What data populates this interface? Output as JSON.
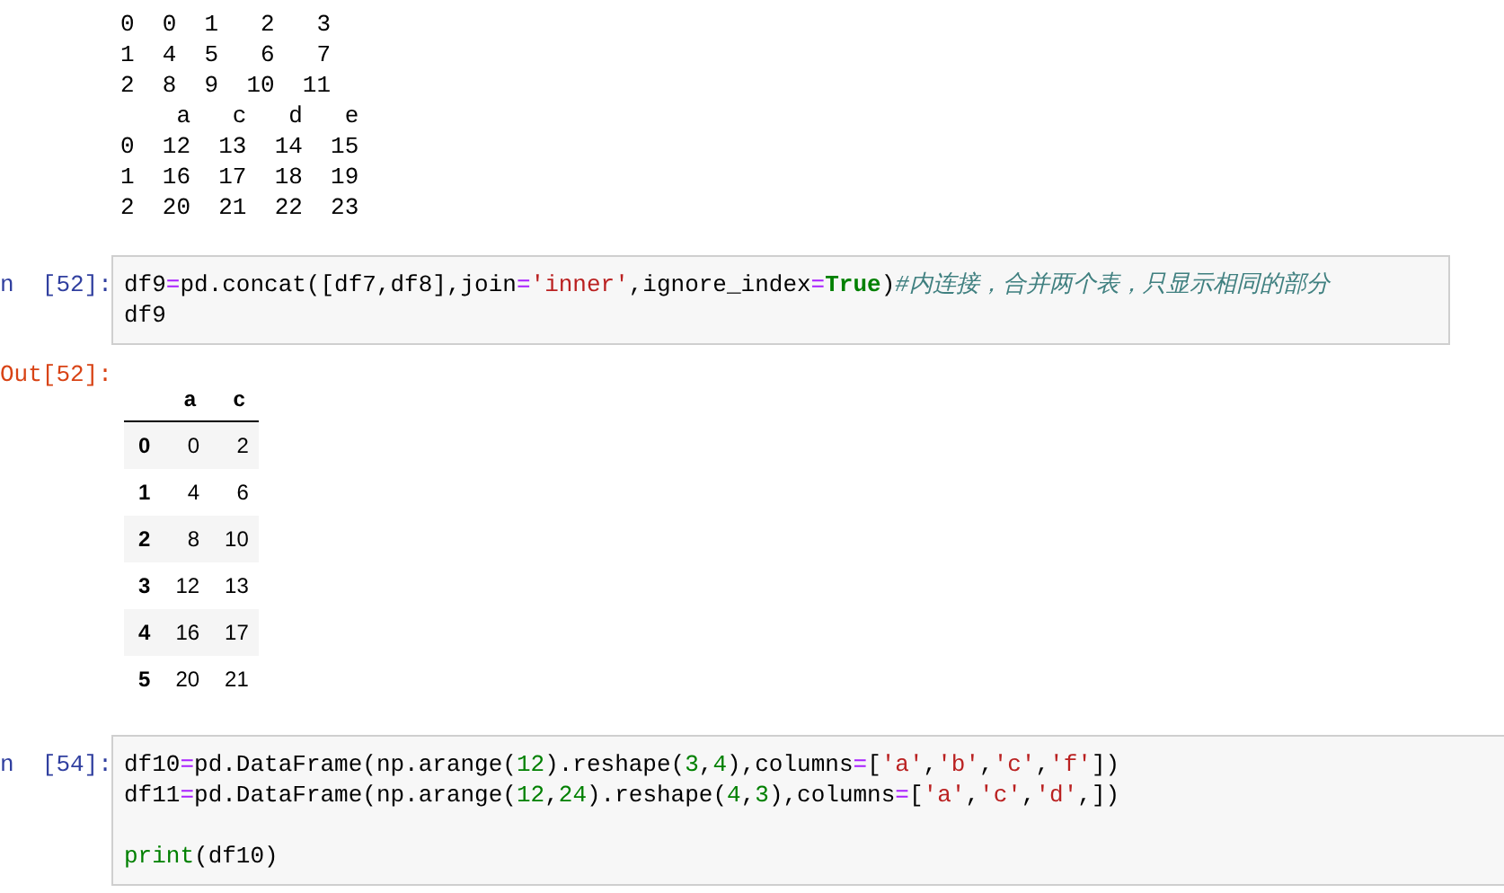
{
  "stdout": {
    "lines": [
      "0  0  1   2   3",
      "1  4  5   6   7",
      "2  8  9  10  11",
      "    a   c   d   e",
      "0  12  13  14  15",
      "1  16  17  18  19",
      "2  20  21  22  23"
    ]
  },
  "cells": [
    {
      "prompt": "n  [52]:",
      "code": [
        [
          {
            "kind": "plain",
            "text": "df9"
          },
          {
            "kind": "op",
            "text": "="
          },
          {
            "kind": "plain",
            "text": "pd.concat([df7,df8],join"
          },
          {
            "kind": "op",
            "text": "="
          },
          {
            "kind": "string",
            "text": "'inner'"
          },
          {
            "kind": "plain",
            "text": ",ignore_index"
          },
          {
            "kind": "op",
            "text": "="
          },
          {
            "kind": "keyword",
            "text": "True"
          },
          {
            "kind": "plain",
            "text": ")"
          },
          {
            "kind": "comment",
            "text": "#内连接，合并两个表，只显示相同的部分"
          }
        ],
        [
          {
            "kind": "plain",
            "text": "df9"
          }
        ]
      ],
      "output": {
        "prompt": "Out[52]:",
        "table": {
          "columns": [
            "a",
            "c"
          ],
          "rows": [
            {
              "index": "0",
              "values": [
                "0",
                "2"
              ]
            },
            {
              "index": "1",
              "values": [
                "4",
                "6"
              ]
            },
            {
              "index": "2",
              "values": [
                "8",
                "10"
              ]
            },
            {
              "index": "3",
              "values": [
                "12",
                "13"
              ]
            },
            {
              "index": "4",
              "values": [
                "16",
                "17"
              ]
            },
            {
              "index": "5",
              "values": [
                "20",
                "21"
              ]
            }
          ]
        }
      }
    },
    {
      "prompt": "n  [54]:",
      "code": [
        [
          {
            "kind": "plain",
            "text": "df10"
          },
          {
            "kind": "op",
            "text": "="
          },
          {
            "kind": "plain",
            "text": "pd.DataFrame(np.arange("
          },
          {
            "kind": "number",
            "text": "12"
          },
          {
            "kind": "plain",
            "text": ").reshape("
          },
          {
            "kind": "number",
            "text": "3"
          },
          {
            "kind": "plain",
            "text": ","
          },
          {
            "kind": "number",
            "text": "4"
          },
          {
            "kind": "plain",
            "text": "),columns"
          },
          {
            "kind": "op",
            "text": "="
          },
          {
            "kind": "plain",
            "text": "["
          },
          {
            "kind": "string",
            "text": "'a'"
          },
          {
            "kind": "plain",
            "text": ","
          },
          {
            "kind": "string",
            "text": "'b'"
          },
          {
            "kind": "plain",
            "text": ","
          },
          {
            "kind": "string",
            "text": "'c'"
          },
          {
            "kind": "plain",
            "text": ","
          },
          {
            "kind": "string",
            "text": "'f'"
          },
          {
            "kind": "plain",
            "text": "])"
          }
        ],
        [
          {
            "kind": "plain",
            "text": "df11"
          },
          {
            "kind": "op",
            "text": "="
          },
          {
            "kind": "plain",
            "text": "pd.DataFrame(np.arange("
          },
          {
            "kind": "number",
            "text": "12"
          },
          {
            "kind": "plain",
            "text": ","
          },
          {
            "kind": "number",
            "text": "24"
          },
          {
            "kind": "plain",
            "text": ").reshape("
          },
          {
            "kind": "number",
            "text": "4"
          },
          {
            "kind": "plain",
            "text": ","
          },
          {
            "kind": "number",
            "text": "3"
          },
          {
            "kind": "plain",
            "text": "),columns"
          },
          {
            "kind": "op",
            "text": "="
          },
          {
            "kind": "plain",
            "text": "["
          },
          {
            "kind": "string",
            "text": "'a'"
          },
          {
            "kind": "plain",
            "text": ","
          },
          {
            "kind": "string",
            "text": "'c'"
          },
          {
            "kind": "plain",
            "text": ","
          },
          {
            "kind": "string",
            "text": "'d'"
          },
          {
            "kind": "plain",
            "text": ",])"
          }
        ],
        [
          {
            "kind": "blank_line"
          },
          {
            "kind": "builtin",
            "text": "print"
          },
          {
            "kind": "plain",
            "text": "(df10)"
          }
        ]
      ]
    }
  ]
}
